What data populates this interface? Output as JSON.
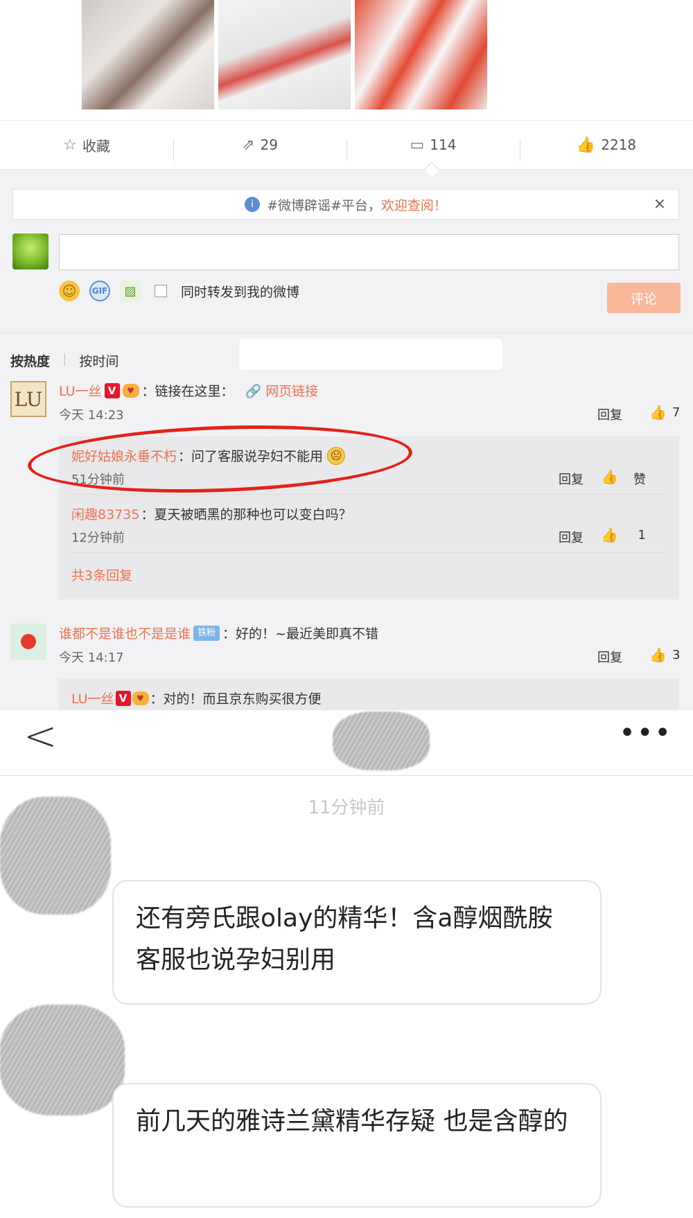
{
  "post": {
    "actions": [
      {
        "icon": "☆",
        "label": "收藏"
      },
      {
        "icon": "⇗",
        "label": "29"
      },
      {
        "icon": "▭",
        "label": "114"
      },
      {
        "icon": "👍",
        "label": "2218"
      }
    ]
  },
  "notice": {
    "prefix": "#微博辟谣#平台，",
    "link": "欢迎查阅！",
    "close": "×"
  },
  "composer": {
    "repost_label": "同时转发到我的微博",
    "submit_label": "评论"
  },
  "sort": {
    "by_heat": "按热度",
    "by_time": "按时间"
  },
  "comments": [
    {
      "user": "LU一丝",
      "badge": "V",
      "text": "：链接在这里：",
      "link": "网页链接",
      "time": "今天 14:23",
      "reply_label": "回复",
      "likes": "7",
      "avatar_text": "LU",
      "replies": [
        {
          "user": "妮好姑娘永垂不朽",
          "text": "：问了客服说孕妇不能用",
          "time": "51分钟前",
          "reply_label": "回复",
          "likes": "赞"
        },
        {
          "user": "闲趣83735",
          "text": "：夏天被晒黑的那种也可以变白吗？",
          "time": "12分钟前",
          "reply_label": "回复",
          "likes": "1"
        }
      ],
      "more_replies": "共3条回复"
    },
    {
      "user": "谁都不是谁也不是是谁",
      "badge": "铁粉",
      "text": "：好的！~最近美即真不错",
      "time": "今天 14:17",
      "reply_label": "回复",
      "likes": "3",
      "replies": [
        {
          "user": "LU一丝",
          "badge": "V",
          "text": "：对的！而且京东购买很方便"
        }
      ]
    }
  ],
  "chat": {
    "back_icon": "<",
    "more_icon": "•••",
    "time": "11分钟前",
    "messages": [
      "还有旁氏跟olay的精华！含a醇烟酰胺 客服也说孕妇别用",
      "前几天的雅诗兰黛精华存疑 也是含醇的"
    ]
  },
  "colors": {
    "accent": "#eb7350",
    "annotation_circle": "#e2231a",
    "submit_disabled": "#f9b89a"
  }
}
